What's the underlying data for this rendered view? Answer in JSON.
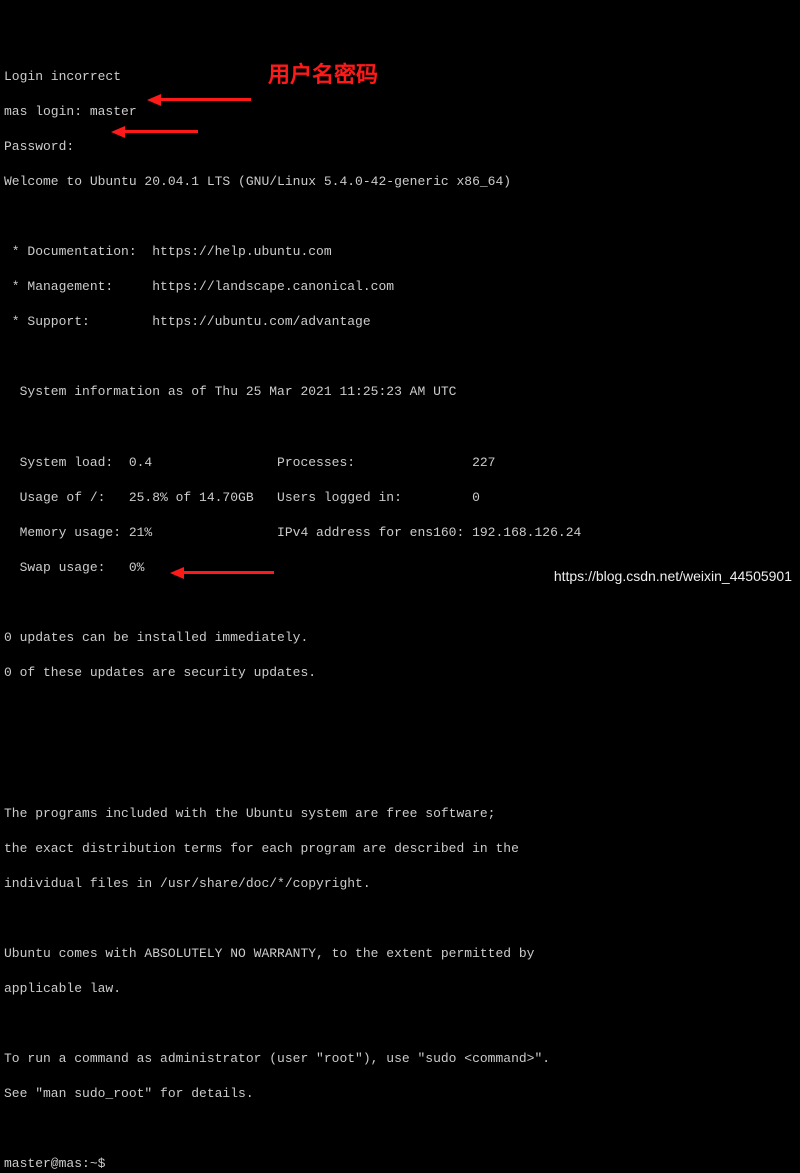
{
  "annotation": {
    "label": "用户名密码"
  },
  "login": {
    "incorrect": "Login incorrect",
    "prompt_login": "mas login: master",
    "prompt_password": "Password:",
    "welcome": "Welcome to Ubuntu 20.04.1 LTS (GNU/Linux 5.4.0-42-generic x86_64)"
  },
  "links": {
    "doc": " * Documentation:  https://help.ubuntu.com",
    "mgmt": " * Management:     https://landscape.canonical.com",
    "support": " * Support:        https://ubuntu.com/advantage"
  },
  "sysinfo_header": "  System information as of Thu 25 Mar 2021 11:25:23 AM UTC",
  "sysinfo": {
    "l1": "  System load:  0.4                Processes:               227",
    "l2": "  Usage of /:   25.8% of 14.70GB   Users logged in:         0",
    "l3": "  Memory usage: 21%                IPv4 address for ens160: 192.168.126.24",
    "l4": "  Swap usage:   0%"
  },
  "updates": {
    "l1": "0 updates can be installed immediately.",
    "l2": "0 of these updates are security updates."
  },
  "legal": {
    "l1": "The programs included with the Ubuntu system are free software;",
    "l2": "the exact distribution terms for each program are described in the",
    "l3": "individual files in /usr/share/doc/*/copyright.",
    "l4": "Ubuntu comes with ABSOLUTELY NO WARRANTY, to the extent permitted by",
    "l5": "applicable law.",
    "l6": "To run a command as administrator (user \"root\"), use \"sudo <command>\".",
    "l7": "See \"man sudo_root\" for details."
  },
  "prompt": "master@mas:~$ ",
  "watermark": "https://blog.csdn.net/weixin_44505901"
}
